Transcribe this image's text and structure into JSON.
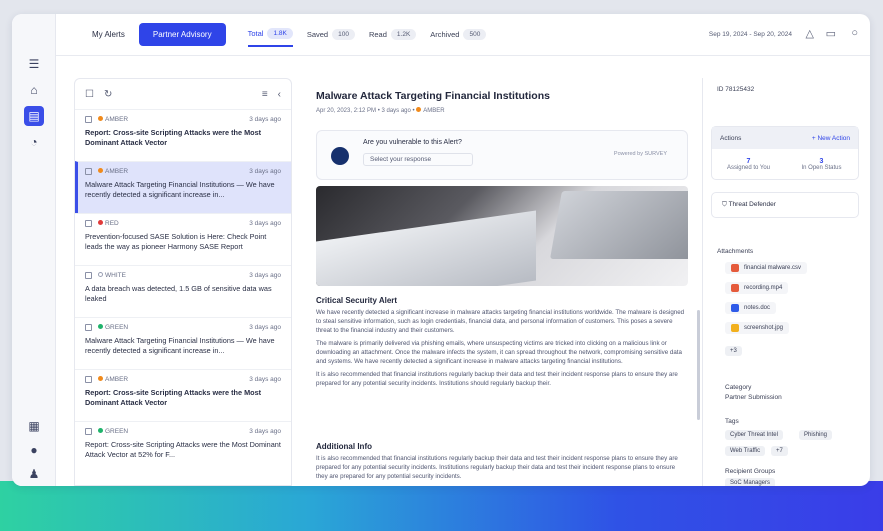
{
  "rail": {
    "top_label": "Logo"
  },
  "topbar": {
    "seg_my_alerts": "My Alerts",
    "seg_partner": "Partner Advisory",
    "tabs": [
      {
        "label": "Total",
        "count": "1.8K"
      },
      {
        "label": "Saved",
        "count": "100"
      },
      {
        "label": "Read",
        "count": "1.2K"
      },
      {
        "label": "Archived",
        "count": "500"
      }
    ],
    "date_range": "Sep 19, 2024 - Sep 20, 2024"
  },
  "list": {
    "items": [
      {
        "level": "AMBER",
        "color": "#f08a1c",
        "time": "3 days ago",
        "title": "Report: Cross-site Scripting Attacks were the Most Dominant Attack Vector",
        "bold": true
      },
      {
        "level": "AMBER",
        "color": "#f08a1c",
        "time": "3 days ago",
        "title": "Malware Attack Targeting Financial Institutions — We have recently detected a significant increase in...",
        "bold": false
      },
      {
        "level": "RED",
        "color": "#e03a3a",
        "time": "3 days ago",
        "title": "Prevention-focused SASE Solution is Here: Check Point leads the way as pioneer Harmony SASE Report",
        "bold": false
      },
      {
        "level": "WHITE",
        "color": "#ffffff",
        "time": "3 days ago",
        "title": "A data breach was detected, 1.5 GB of sensitive data was leaked",
        "bold": false
      },
      {
        "level": "GREEN",
        "color": "#1fb36b",
        "time": "3 days ago",
        "title": "Malware Attack Targeting Financial Institutions — We have recently detected a significant increase in...",
        "bold": false
      },
      {
        "level": "AMBER",
        "color": "#f08a1c",
        "time": "3 days ago",
        "title": "Report: Cross-site Scripting Attacks were the Most Dominant Attack Vector",
        "bold": true
      },
      {
        "level": "GREEN",
        "color": "#1fb36b",
        "time": "3 days ago",
        "title": "Report: Cross-site Scripting Attacks were the Most Dominant Attack Vector at 52% for F...",
        "bold": false
      }
    ]
  },
  "detail": {
    "title": "Malware Attack Targeting Financial Institutions",
    "subtitle": "Apr 20, 2023, 2:12 PM • 3 days ago •",
    "level": "AMBER",
    "survey_question": "Are you vulnerable to this Alert?",
    "survey_select": "Select your response",
    "survey_powered": "Powered by SURVEY",
    "sec1_title": "Critical Security Alert",
    "sec1_p1": "We have recently detected a significant increase in malware attacks targeting financial institutions worldwide. The malware is designed to steal sensitive information, such as login credentials, financial data, and personal information of customers. This poses a severe threat to the financial industry and their customers.",
    "sec1_p2": "The malware is primarily delivered via phishing emails, where unsuspecting victims are tricked into clicking on a malicious link or downloading an attachment. Once the malware infects the system, it can spread throughout the network, compromising sensitive data and systems. We have recently detected a significant increase in malware attacks targeting financial institutions.",
    "sec1_p3": "It is also recommended that financial institutions regularly backup their data and test their incident response plans to ensure they are prepared for any potential security incidents. Institutions should regularly backup their.",
    "sec2_title": "Additional Info",
    "sec2_p1": "It is also recommended that financial institutions regularly backup their data and test their incident response plans to ensure they are prepared for any potential security incidents. Institutions regularly backup their data and test their incident response plans to ensure they are prepared for any potential security incidents."
  },
  "right": {
    "id": "ID 78125432",
    "actions_label": "Actions",
    "new_action": "+ New Action",
    "assigned_count": "7",
    "assigned_label": "Assigned to You",
    "open_count": "3",
    "open_label": "In Open Status",
    "threat_defender": "Threat Defender",
    "attachments_label": "Attachments",
    "attachments": [
      {
        "name": "financial malware.csv",
        "color": "#e55b3c"
      },
      {
        "name": "recording.mp4",
        "color": "#e55b3c"
      },
      {
        "name": "notes.doc",
        "color": "#2f5be8"
      },
      {
        "name": "screenshot.jpg",
        "color": "#f2b01e"
      }
    ],
    "more_count": "+3",
    "category_label": "Category",
    "category_value": "Partner Submission",
    "tags_label": "Tags",
    "tags": [
      "Cyber Threat Intel",
      "Phishing",
      "Web Traffic",
      "+7"
    ],
    "recipient_label": "Recipient Groups",
    "recipient_value": "SoC Managers"
  }
}
